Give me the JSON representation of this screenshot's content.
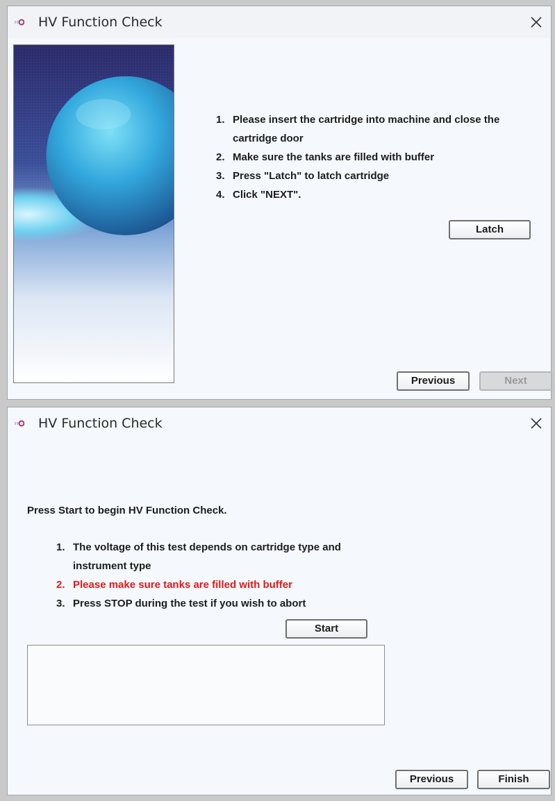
{
  "dialog1": {
    "title": "HV Function Check",
    "instructions": [
      {
        "num": "1.",
        "text": "Please insert the cartridge into machine and close the cartridge door"
      },
      {
        "num": "2.",
        "text": "Make sure the tanks are filled with buffer"
      },
      {
        "num": "3.",
        "text": "Press \"Latch\" to latch cartridge"
      },
      {
        "num": "4.",
        "text": "Click \"NEXT\"."
      }
    ],
    "latch_label": "Latch",
    "previous_label": "Previous",
    "next_label": "Next",
    "next_disabled": true
  },
  "dialog2": {
    "title": "HV Function Check",
    "intro": "Press Start to begin HV Function Check.",
    "instructions": [
      {
        "num": "1.",
        "text": "The voltage of this test depends on cartridge type and instrument type"
      },
      {
        "num": "2.",
        "text": "Please make sure tanks are filled with buffer"
      },
      {
        "num": "3.",
        "text": "Press STOP during the test if you wish to abort"
      }
    ],
    "start_label": "Start",
    "output_text": "",
    "previous_label": "Previous",
    "finish_label": "Finish"
  },
  "icons": {
    "app": "app-icon",
    "close": "close-icon",
    "side_image": "wizard-sphere-image"
  },
  "colors": {
    "warning_text": "#e11a1a",
    "dialog_bg": "#f5f8fc",
    "disabled_button": "#d8d9db"
  }
}
